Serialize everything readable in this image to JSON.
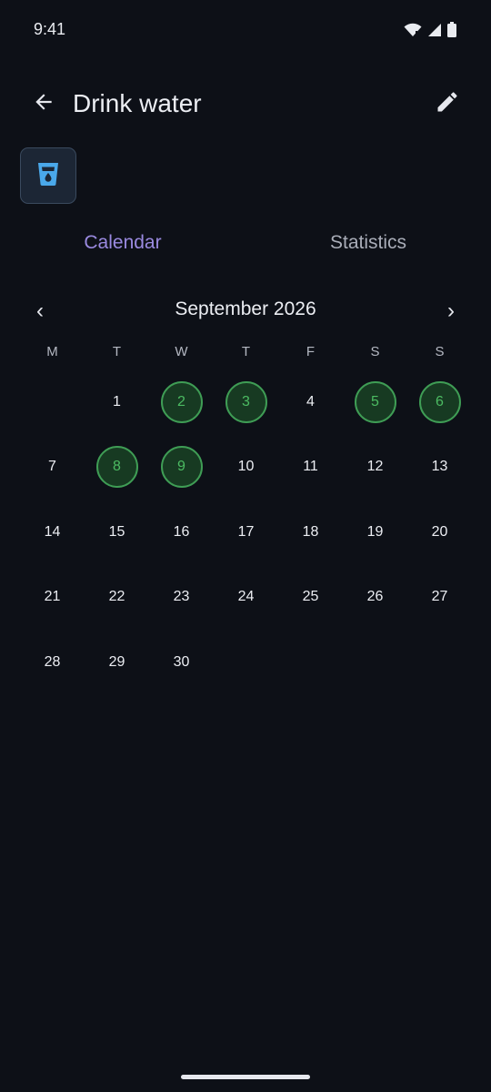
{
  "status_bar": {
    "time": "9:41"
  },
  "header": {
    "title": "Drink water"
  },
  "tabs": [
    {
      "label": "Calendar",
      "active": true
    },
    {
      "label": "Statistics",
      "active": false
    }
  ],
  "calendar": {
    "month_label": "September 2026",
    "prev_symbol": "‹",
    "next_symbol": "›",
    "weekdays": [
      "M",
      "T",
      "W",
      "T",
      "F",
      "S",
      "S"
    ],
    "leading_blanks": 1,
    "days_in_month": 30,
    "completed_days": [
      2,
      3,
      5,
      6,
      8,
      9
    ]
  },
  "colors": {
    "accent": "#9a8ae0",
    "completed_ring": "#3f9d55",
    "completed_text": "#4cbb62",
    "icon_blue": "#4aa8ea"
  },
  "icons": {
    "back": "arrow-left-icon",
    "edit": "pencil-icon",
    "habit": "water-glass-icon"
  }
}
